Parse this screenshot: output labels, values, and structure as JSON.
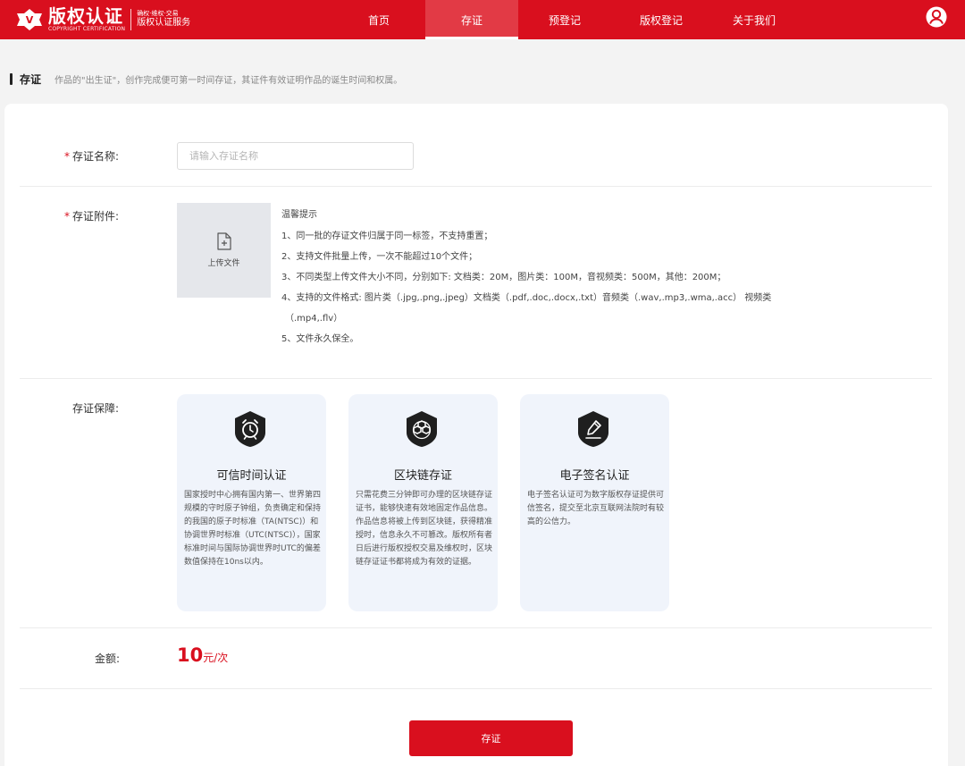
{
  "header": {
    "logo": {
      "title": "版权认证",
      "subtitle_en": "COPYRIGHT CERTIFICATION",
      "tagline": "确权·维权·交易",
      "service": "版权认证服务"
    },
    "nav": [
      {
        "label": "首页",
        "active": false
      },
      {
        "label": "存证",
        "active": true
      },
      {
        "label": "预登记",
        "active": false
      },
      {
        "label": "版权登记",
        "active": false
      },
      {
        "label": "关于我们",
        "active": false
      }
    ],
    "user_icon": "user-circle-icon"
  },
  "intro": {
    "title": "存证",
    "description": "作品的\"出生证\"，创作完成便可第一时间存证，其证件有效证明作品的诞生时间和权属。"
  },
  "form": {
    "name": {
      "required_mark": "*",
      "label": "存证名称:",
      "placeholder": "请输入存证名称",
      "value": ""
    },
    "attachment": {
      "required_mark": "*",
      "label": "存证附件:",
      "upload_label": "上传文件",
      "upload_icon": "file-plus-icon",
      "tips_title": "温馨提示",
      "tips": [
        "1、同一批的存证文件归属于同一标签，不支持重置；",
        "2、支持文件批量上传，一次不能超过10个文件；",
        "3、不同类型上传文件大小不同，分别如下: 文档类：20M，图片类：100M，音视频类：500M，其他：200M；",
        "4、支持的文件格式: 图片类（.jpg,.png,.jpeg）文档类（.pdf,.doc,.docx,.txt）音频类（.wav,.mp3,.wma,.acc） 视频类",
        "（.mp4,.flv）",
        "5、文件永久保全。"
      ]
    },
    "guarantee": {
      "label": "存证保障:",
      "items": [
        {
          "icon": "alarm-clock-shield-icon",
          "title": "可信时间认证",
          "description": "国家授时中心拥有国内第一、世界第四规模的守时原子钟组，负责确定和保持的我国的原子时标准（TA(NTSC)）和协调世界时标准（UTC(NTSC)），国家标准时间与国际协调世界时UTC的偏差数值保持在10ns以内。"
        },
        {
          "icon": "blockchain-shield-icon",
          "title": "区块链存证",
          "description": "只需花费三分钟即可办理的区块链存证证书，能够快速有效地固定作品信息。作品信息将被上传到区块链，获得精准授时，信息永久不可篡改。版权所有者日后进行版权授权交易及维权时，区块链存证证书都将成为有效的证据。"
        },
        {
          "icon": "signature-pen-shield-icon",
          "title": "电子签名认证",
          "description": "电子签名认证可为数字版权存证提供可信签名，提交至北京互联网法院时有较高的公信力。"
        }
      ]
    },
    "amount": {
      "label": "金额:",
      "value": "10",
      "unit": "元/次"
    },
    "submit_label": "存证"
  },
  "colors": {
    "brand_red": "#d90f1e",
    "card_bg": "#f0f4fb",
    "page_bg": "#f3f3f3"
  }
}
